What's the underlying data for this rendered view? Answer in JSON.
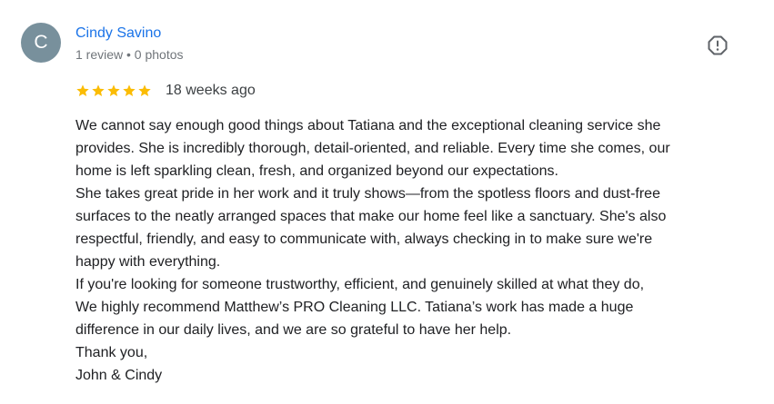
{
  "review": {
    "reviewer": {
      "initial": "C",
      "name": "Cindy Savino",
      "meta": "1 review • 0 photos",
      "avatar_color": "#78909c"
    },
    "rating": {
      "stars": 5,
      "max": 5,
      "star_color": "#fbbc04"
    },
    "date": "18 weeks ago",
    "report_icon": "report-flag-icon",
    "text_lines": [
      "We cannot say enough good things about Tatiana and the exceptional cleaning service she",
      "provides. She is incredibly thorough, detail-oriented, and reliable. Every time she comes, our",
      "home is left sparkling clean, fresh, and organized beyond our expectations.",
      "She takes great pride in her work and it truly shows—from the spotless floors and dust-free",
      "surfaces to the neatly arranged spaces that make our home feel like a sanctuary. She's also",
      "respectful, friendly, and easy to communicate with, always checking in to make sure we're",
      "happy with everything.",
      "If you're looking for someone trustworthy, efficient, and genuinely skilled at what they do,",
      "We highly recommend Matthew’s PRO Cleaning LLC. Tatiana’s work has made a huge",
      "difference in our daily lives, and we are so grateful to have her help.",
      "Thank you,",
      "John & Cindy"
    ]
  }
}
